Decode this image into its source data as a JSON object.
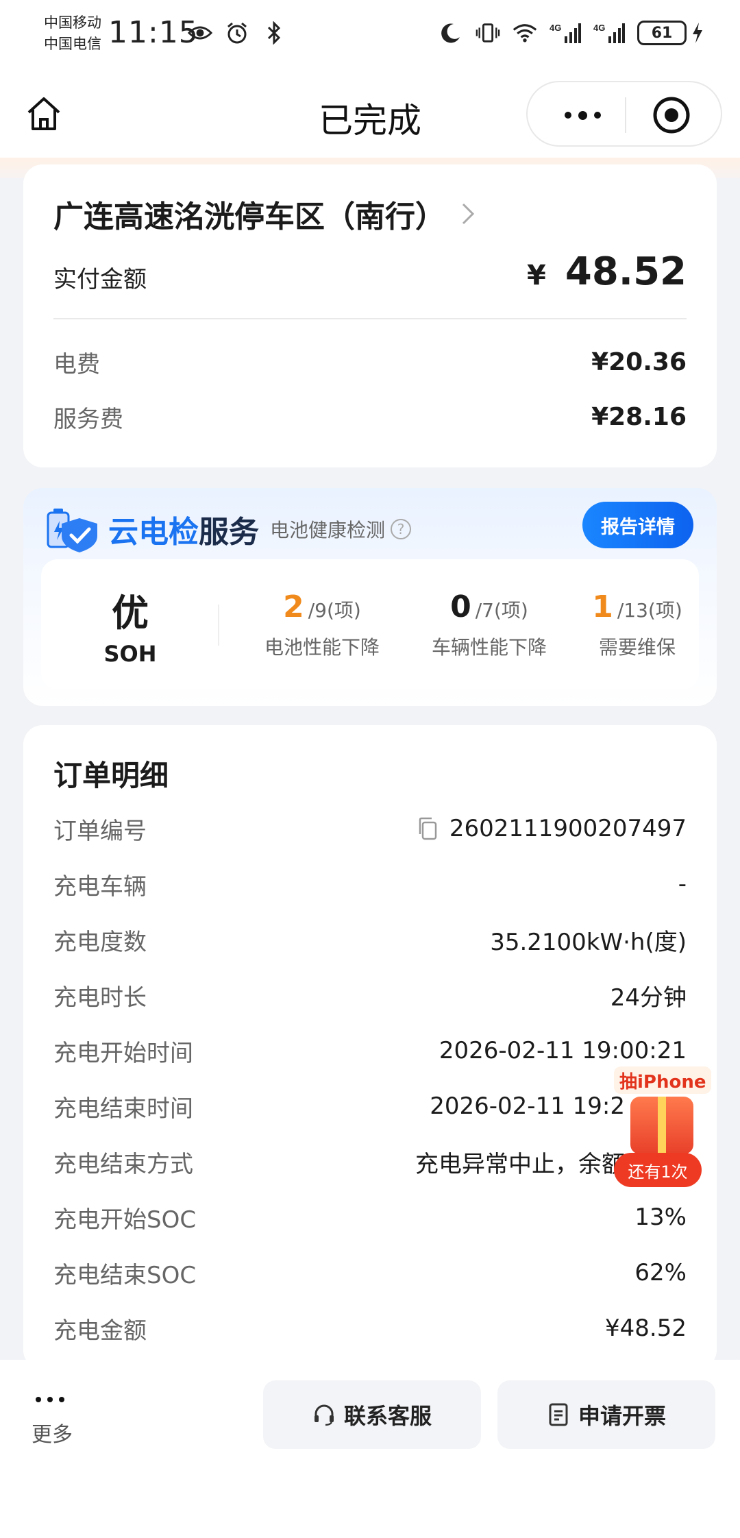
{
  "status_bar": {
    "carrier_1": "中国移动",
    "carrier_2": "中国电信",
    "time": "11:15",
    "signal_1": "4G",
    "signal_2": "4G",
    "battery": "61"
  },
  "nav": {
    "title": "已完成"
  },
  "station": {
    "name": "广连高速洺洸停车区（南行）",
    "paid_label": "实付金额",
    "currency": "¥",
    "paid_amount": "48.52",
    "fees": [
      {
        "label": "电费",
        "value": "¥20.36"
      },
      {
        "label": "服务费",
        "value": "¥28.16"
      }
    ]
  },
  "cloud_check": {
    "title_blue": "云电检",
    "title_dark": "服务",
    "subtitle": "电池健康检测",
    "help": "?",
    "report_button": "报告详情",
    "soh_grade": "优",
    "soh_label": "SOH",
    "stats": [
      {
        "num": "2",
        "den": "/9(项)",
        "label": "电池性能下降",
        "color": "#f08a1c"
      },
      {
        "num": "0",
        "den": "/7(项)",
        "label": "车辆性能下降",
        "color": "#1b1b1b"
      },
      {
        "num": "1",
        "den": "/13(项)",
        "label": "需要维保",
        "color": "#f08a1c"
      }
    ]
  },
  "order": {
    "title": "订单明细",
    "rows": [
      {
        "label": "订单编号",
        "value": "2602111900207497"
      },
      {
        "label": "充电车辆",
        "value": "-"
      },
      {
        "label": "充电度数",
        "value": "35.2100kW·h(度)"
      },
      {
        "label": "充电时长",
        "value": "24分钟"
      },
      {
        "label": "充电开始时间",
        "value": "2026-02-11 19:00:21"
      },
      {
        "label": "充电结束时间",
        "value": "2026-02-11 19:2"
      },
      {
        "label": "充电结束方式",
        "value": "充电异常中止，余额"
      },
      {
        "label": "充电开始SOC",
        "value": "13%"
      },
      {
        "label": "充电结束SOC",
        "value": "62%"
      },
      {
        "label": "充电金额",
        "value": "¥48.52"
      }
    ]
  },
  "promo": {
    "top": "抽iPhone",
    "bottom": "还有1次"
  },
  "bottom_bar": {
    "more_label": "更多",
    "service_button": "联系客服",
    "invoice_button": "申请开票"
  },
  "colors": {
    "accent_blue": "#1a73f0",
    "accent_orange": "#f08a1c",
    "promo_red": "#ee3a22"
  }
}
